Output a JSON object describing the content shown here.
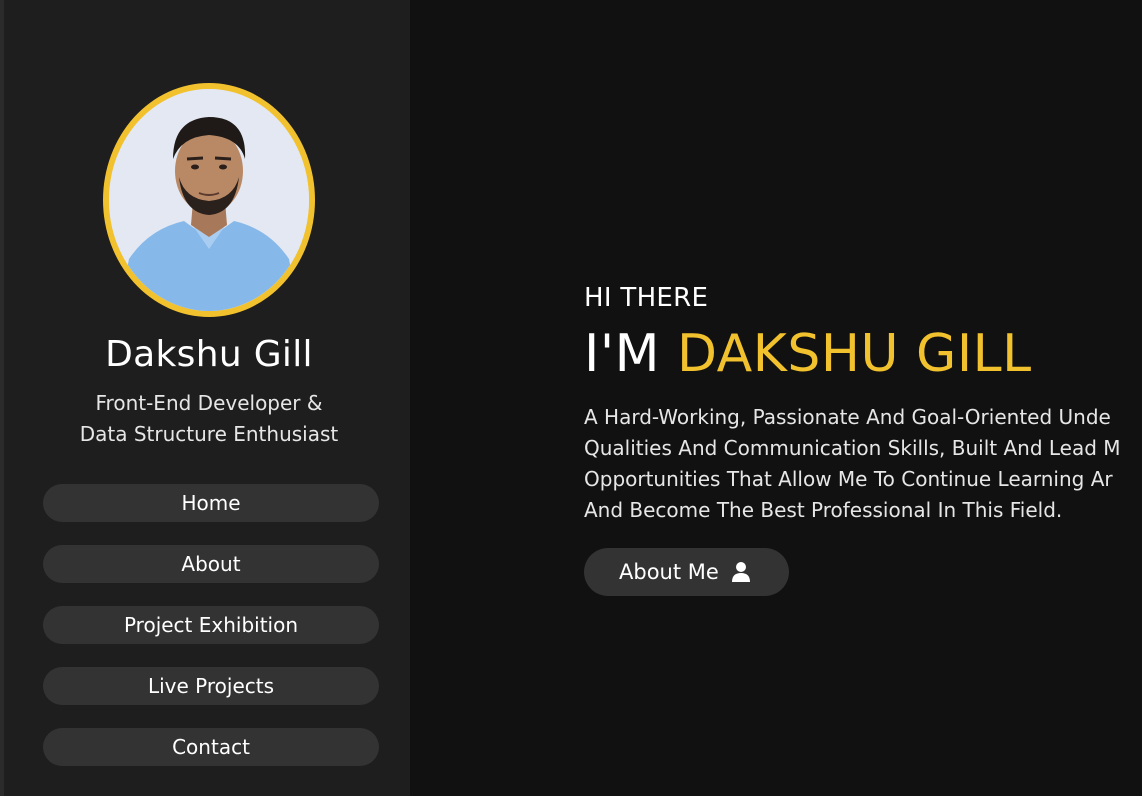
{
  "profile": {
    "name": "Dakshu Gill",
    "role_line1": "Front-End Developer &",
    "role_line2": "Data Structure Enthusiast"
  },
  "nav": {
    "items": [
      {
        "label": "Home"
      },
      {
        "label": "About"
      },
      {
        "label": "Project Exhibition"
      },
      {
        "label": "Live Projects"
      },
      {
        "label": "Contact"
      }
    ]
  },
  "hero": {
    "greeting": "HI THERE",
    "headline_prefix": "I'M ",
    "headline_name": "DAKSHU GILL",
    "bio_lines": [
      "A Hard-Working, Passionate And Goal-Oriented Unde",
      "Qualities And Communication Skills, Built And Lead M",
      "Opportunities That Allow Me To Continue Learning Ar",
      "And Become The Best Professional In This Field."
    ],
    "cta_label": "About Me",
    "cta_icon": "user-icon"
  },
  "colors": {
    "accent": "#f2c12e",
    "sidebar_bg": "#1e1e1e",
    "main_bg": "#111111",
    "button_bg": "#333333"
  }
}
